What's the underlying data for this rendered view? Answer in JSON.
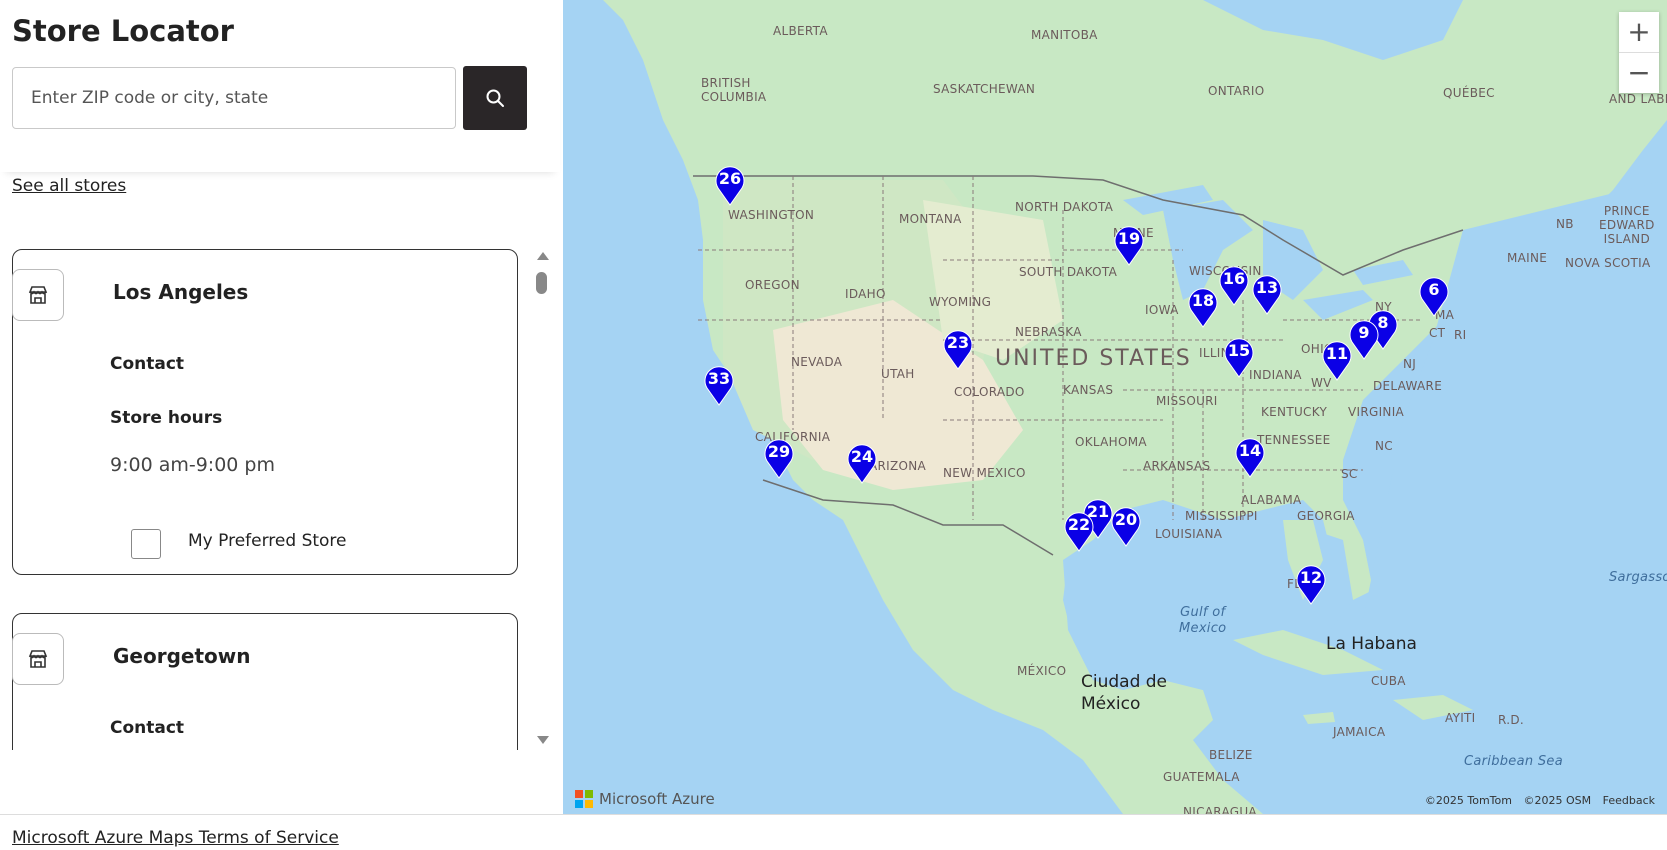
{
  "title": "Store Locator",
  "search": {
    "placeholder": "Enter ZIP code or city, state",
    "button_icon": "search-icon"
  },
  "see_all_label": "See all stores",
  "stores": [
    {
      "name": "Los Angeles",
      "contact_label": "Contact",
      "hours_label": "Store hours",
      "hours": "9:00 am-9:00 pm",
      "preferred_label": "My Preferred Store",
      "icon": "store-icon"
    },
    {
      "name": "Georgetown",
      "contact_label": "Contact",
      "icon": "store-icon"
    }
  ],
  "footer": {
    "tos_label": "Microsoft Azure Maps Terms of Service"
  },
  "map": {
    "zoom_in": "+",
    "zoom_out": "−",
    "brand": "Microsoft Azure",
    "attribution": [
      "©2025 TomTom",
      "©2025 OSM",
      "Feedback"
    ],
    "pin_color": "#0b00e6",
    "labels": {
      "alberta": "ALBERTA",
      "manitoba": "MANITOBA",
      "british_columbia": "BRITISH\nCOLUMBIA",
      "saskatchewan": "SASKATCHEWAN",
      "ontario": "ONTARIO",
      "quebec": "QUÉBEC",
      "and_labr": "AND LABR",
      "north_dakota": "NORTH DAKOTA",
      "washington": "WASHINGTON",
      "montana": "MONTANA",
      "minnesota": "MINNE",
      "south_dakota": "SOUTH DAKOTA",
      "wisconsin": "WISCONSIN",
      "oregon": "OREGON",
      "idaho": "IDAHO",
      "wyoming": "WYOMING",
      "iowa": "IOWA",
      "nebraska": "NEBRASKA",
      "united_states": "UNITED STATES",
      "illinois": "ILLINOIS",
      "indiana": "INDIANA",
      "ohio": "OHIO",
      "nevada": "NEVADA",
      "utah": "UTAH",
      "colorado": "COLORADO",
      "kansas": "KANSAS",
      "missouri": "MISSOURI",
      "kentucky": "KENTUCKY",
      "virginia": "VIRGINIA",
      "wv": "WV",
      "delaware": "DELAWARE",
      "nj": "NJ",
      "ny": "NY",
      "ma": "MA",
      "ct": "CT",
      "ri": "RI",
      "maine": "MAINE",
      "nb": "NB",
      "prince_edward": "PRINCE\nEDWARD\nISLAND",
      "nova_scotia": "NOVA SCOTIA",
      "california": "CALIFORNIA",
      "arizona": "ARIZONA",
      "new_mexico": "NEW MEXICO",
      "oklahoma": "OKLAHOMA",
      "tennessee": "TENNESSEE",
      "nc": "NC",
      "arkansas": "ARKANSAS",
      "sc": "SC",
      "mississippi": "MISSISSIPPI",
      "alabama": "ALABAMA",
      "georgia": "GEORGIA",
      "louisiana": "LOUISIANA",
      "florida": "FLOR",
      "mexico": "MÉXICO",
      "gulf_of_mexico": "Gulf of\nMexico",
      "la_habana": "La Habana",
      "ciudad_de_mexico": "Ciudad de\nMéxico",
      "cuba": "CUBA",
      "belize": "BELIZE",
      "guatemala": "GUATEMALA",
      "jamaica": "JAMAICA",
      "ayiti": "AYITI",
      "rd": "R.D.",
      "caribbean_sea": "Caribbean Sea",
      "sargasso": "Sargasso",
      "nicaragua": "NICARAGUA"
    },
    "pins": [
      "26",
      "19",
      "16",
      "18",
      "13",
      "6",
      "8",
      "9",
      "11",
      "15",
      "23",
      "33",
      "29",
      "24",
      "14",
      "21",
      "22",
      "20",
      "12"
    ]
  }
}
